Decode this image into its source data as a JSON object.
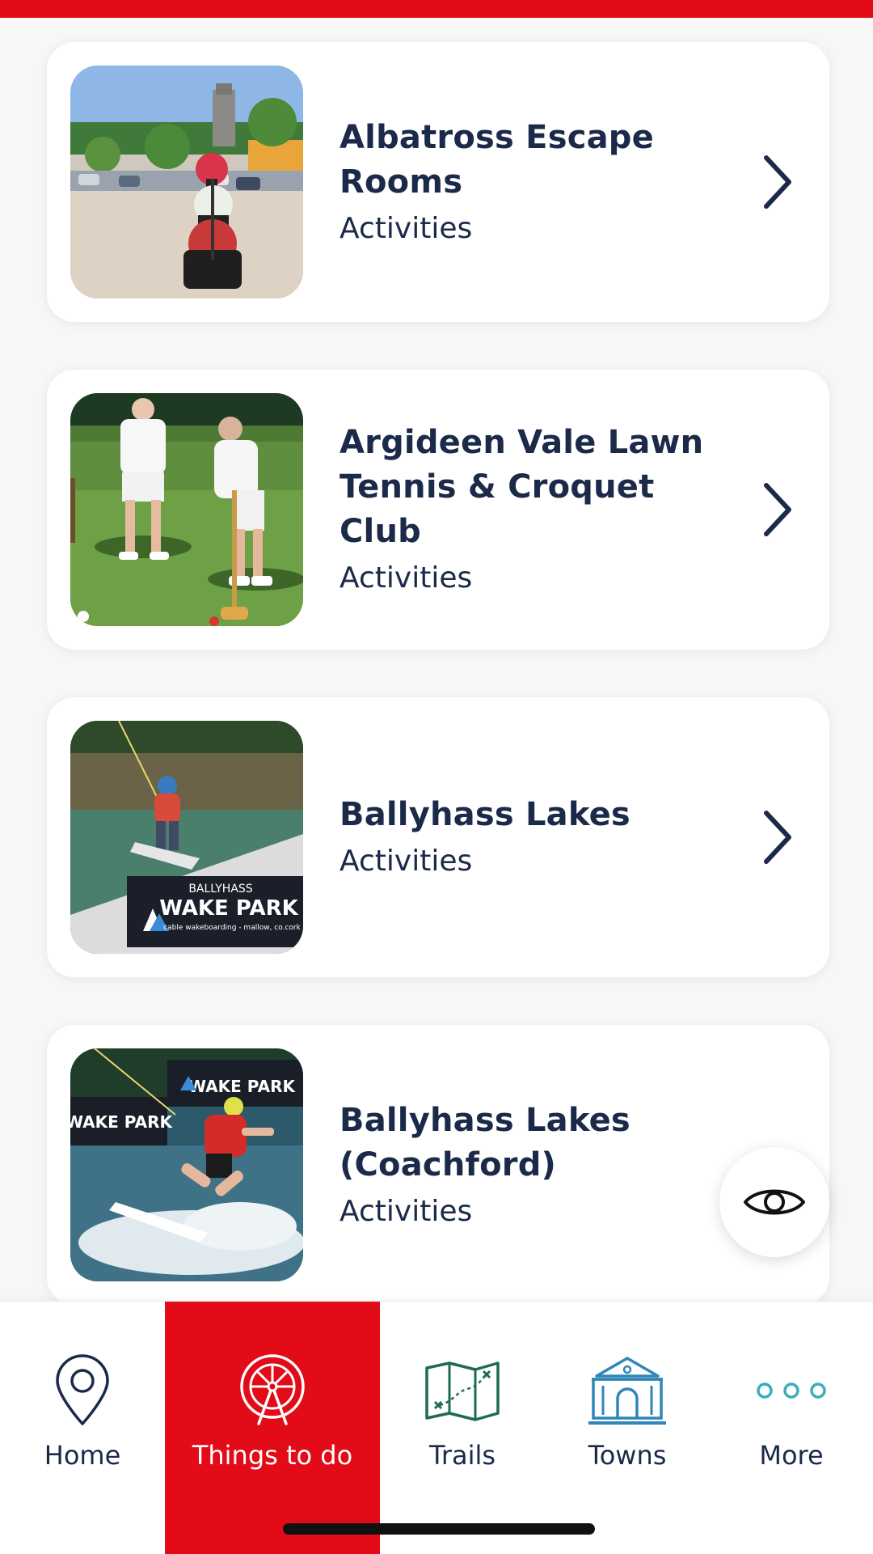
{
  "colors": {
    "brand_red": "#e30b17",
    "text_navy": "#1c2a4a",
    "trails_green": "#1d6b55",
    "towns_blue": "#2f86b8",
    "more_teal": "#3aaebc"
  },
  "listings": [
    {
      "title": "Albatross Escape Rooms",
      "category": "Activities",
      "image": "town-square-flower-planters"
    },
    {
      "title": "Argideen Vale Lawn Tennis & Croquet Club",
      "category": "Activities",
      "image": "croquet-players-on-lawn"
    },
    {
      "title": "Ballyhass Lakes",
      "category": "Activities",
      "image": "child-wakeboarding"
    },
    {
      "title": "Ballyhass Lakes (Coachford)",
      "category": "Activities",
      "image": "wakeboarder-on-water"
    }
  ],
  "images": {
    "wake_park_sign": {
      "line1": "BALLYHASS",
      "line2": "WAKE PARK",
      "line3": "cable wakeboarding - mallow, co.cork"
    }
  },
  "nav": {
    "items": [
      {
        "label": "Home",
        "icon": "map-pin-icon",
        "active": false
      },
      {
        "label": "Things to do",
        "icon": "ferris-wheel-icon",
        "active": true
      },
      {
        "label": "Trails",
        "icon": "map-icon",
        "active": false
      },
      {
        "label": "Towns",
        "icon": "town-hall-icon",
        "active": false
      },
      {
        "label": "More",
        "icon": "more-dots-icon",
        "active": false
      }
    ]
  },
  "fab": {
    "icon": "eye-icon"
  }
}
